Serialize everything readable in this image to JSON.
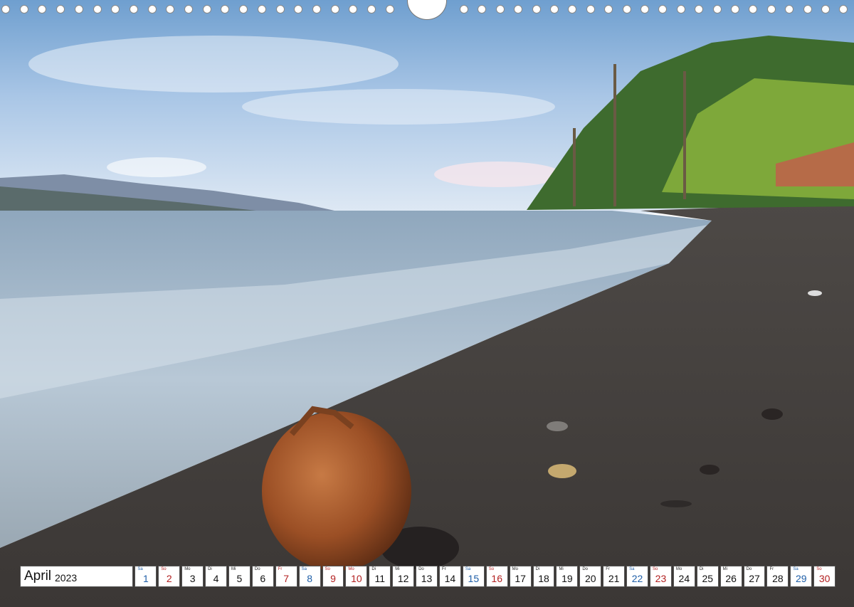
{
  "calendar": {
    "month": "April",
    "year": "2023",
    "days": [
      {
        "wd": "Sa",
        "d": "1",
        "t": "sat"
      },
      {
        "wd": "So",
        "d": "2",
        "t": "sun"
      },
      {
        "wd": "Mo",
        "d": "3",
        "t": ""
      },
      {
        "wd": "Di",
        "d": "4",
        "t": ""
      },
      {
        "wd": "Mi",
        "d": "5",
        "t": ""
      },
      {
        "wd": "Do",
        "d": "6",
        "t": ""
      },
      {
        "wd": "Fr",
        "d": "7",
        "t": "sun"
      },
      {
        "wd": "Sa",
        "d": "8",
        "t": "sat"
      },
      {
        "wd": "So",
        "d": "9",
        "t": "sun"
      },
      {
        "wd": "Mo",
        "d": "10",
        "t": "sun"
      },
      {
        "wd": "Di",
        "d": "11",
        "t": ""
      },
      {
        "wd": "Mi",
        "d": "12",
        "t": ""
      },
      {
        "wd": "Do",
        "d": "13",
        "t": ""
      },
      {
        "wd": "Fr",
        "d": "14",
        "t": ""
      },
      {
        "wd": "Sa",
        "d": "15",
        "t": "sat"
      },
      {
        "wd": "So",
        "d": "16",
        "t": "sun"
      },
      {
        "wd": "Mo",
        "d": "17",
        "t": ""
      },
      {
        "wd": "Di",
        "d": "18",
        "t": ""
      },
      {
        "wd": "Mi",
        "d": "19",
        "t": ""
      },
      {
        "wd": "Do",
        "d": "20",
        "t": ""
      },
      {
        "wd": "Fr",
        "d": "21",
        "t": ""
      },
      {
        "wd": "Sa",
        "d": "22",
        "t": "sat"
      },
      {
        "wd": "So",
        "d": "23",
        "t": "sun"
      },
      {
        "wd": "Mo",
        "d": "24",
        "t": ""
      },
      {
        "wd": "Di",
        "d": "25",
        "t": ""
      },
      {
        "wd": "Mi",
        "d": "26",
        "t": ""
      },
      {
        "wd": "Do",
        "d": "27",
        "t": ""
      },
      {
        "wd": "Fr",
        "d": "28",
        "t": ""
      },
      {
        "wd": "Sa",
        "d": "29",
        "t": "sat"
      },
      {
        "wd": "So",
        "d": "30",
        "t": "sun"
      }
    ]
  },
  "colors": {
    "saturday": "#1f5fa8",
    "sunday_holiday": "#b32020"
  }
}
